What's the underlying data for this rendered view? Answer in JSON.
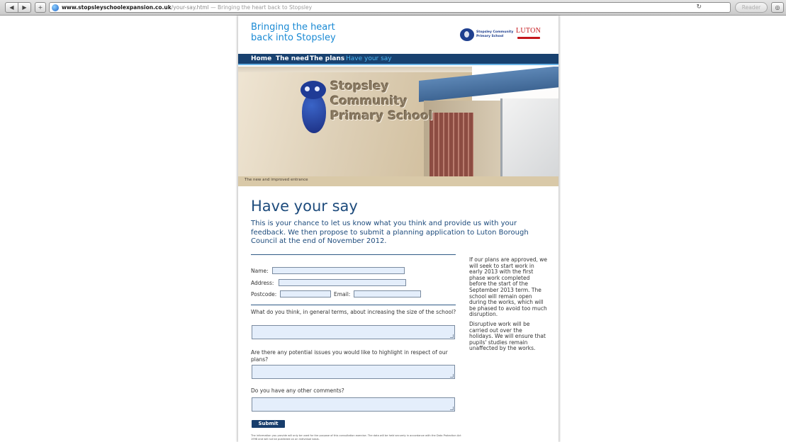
{
  "browser": {
    "url_host": "www.stopsleyschoolexpansion.co.uk",
    "url_path": "/your-say.html",
    "page_title": "— Bringing the heart back to Stopsley",
    "reader_label": "Reader",
    "back_glyph": "◀",
    "forward_glyph": "▶",
    "add_glyph": "+",
    "reload_glyph": "↻",
    "downloads_glyph": "◎"
  },
  "header": {
    "tagline_line1": "Bringing the heart",
    "tagline_line2": "back into Stopsley",
    "school_logo_line1": "Stopsley Community",
    "school_logo_line2": "Primary School",
    "council_logo": "LUTON"
  },
  "nav": {
    "items": [
      {
        "label": "Home"
      },
      {
        "label": "The need"
      },
      {
        "label": "The plans"
      },
      {
        "label": "Have your say"
      }
    ]
  },
  "hero": {
    "sign_line1": "Stopsley",
    "sign_line2": "Community",
    "sign_line3": "Primary School",
    "caption": "The new and improved entrance"
  },
  "main": {
    "heading": "Have your say",
    "intro": "This is your chance to let us know what you think and provide us with your feedback. We then propose to submit a planning application to Luton Borough Council at the end of November 2012."
  },
  "form": {
    "name_label": "Name:",
    "address_label": "Address:",
    "postcode_label": "Postcode:",
    "email_label": "Email:",
    "name_value": "",
    "address_value": "",
    "postcode_value": "",
    "email_value": "",
    "q1": "What do you think, in general terms, about increasing the size of the school?",
    "q2": "Are there any potential issues you would like to highlight in respect of our plans?",
    "q3": "Do you have any other comments?",
    "submit_label": "Submit form",
    "fineprint": "The information you provide will only be used for the purpose of this consultation exercise. The data will be held securely in accordance with the Data Protection Act 1998 and will not be published on an individual basis."
  },
  "sidebar": {
    "para1": "If our plans are approved, we will seek to start work in early 2013 with the first phase work completed before the start of the September 2013 term. The school will remain open during the works, which will be phased to avoid too much disruption.",
    "para2": "Disruptive work will be carried out over the holidays. We will ensure that pupils' studies remain unaffected by the works."
  },
  "colors": {
    "nav_bg": "#18416f",
    "nav_active": "#4bb6f2",
    "heading": "#1d4b7c",
    "tagline": "#1a8ad4",
    "field_bg": "#e4eefb",
    "submit_bg": "#173d6c",
    "council_red": "#c4161c"
  }
}
